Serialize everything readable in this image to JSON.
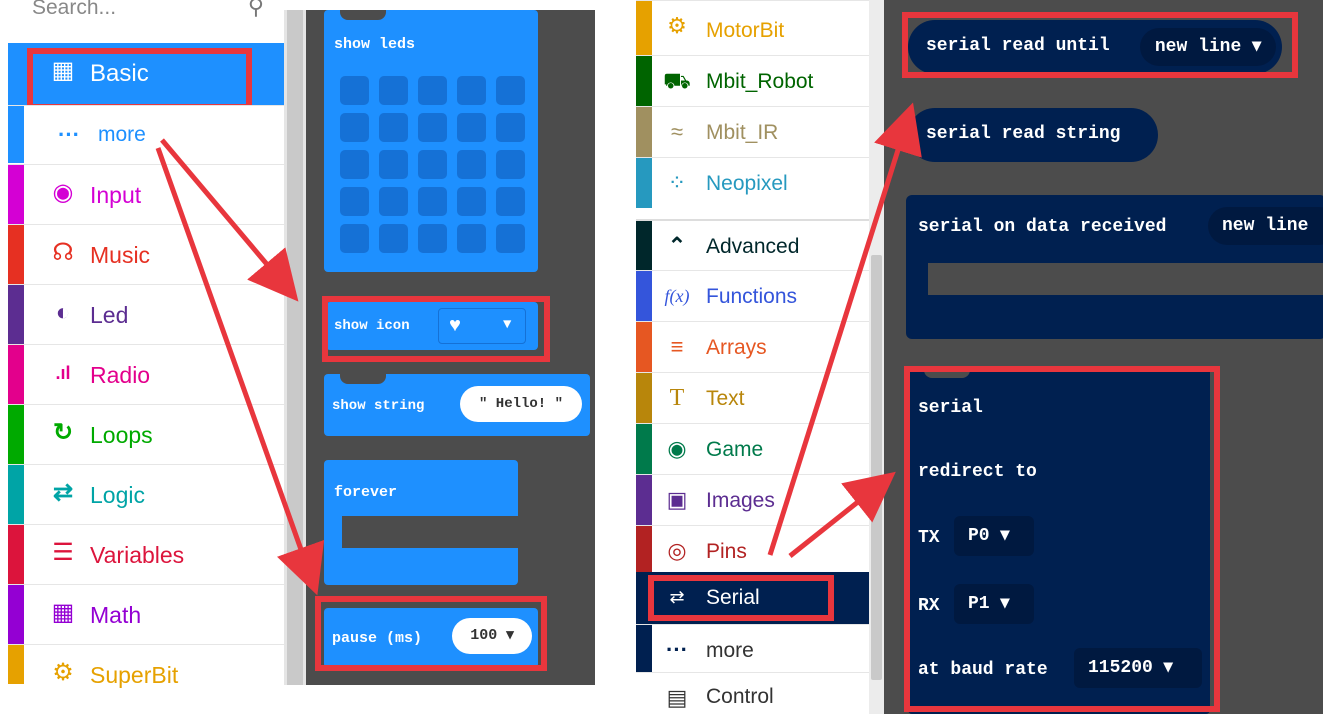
{
  "left": {
    "search_placeholder": "Search...",
    "categories": [
      {
        "label": "Basic",
        "icon": "grid-icon",
        "color": "#1e90ff"
      },
      {
        "label": "more",
        "icon": "dots-icon",
        "color": "#1e90ff"
      },
      {
        "label": "Input",
        "icon": "radio-target-icon",
        "color": "#d400d4"
      },
      {
        "label": "Music",
        "icon": "headphones-icon",
        "color": "#e63022"
      },
      {
        "label": "Led",
        "icon": "toggle-icon",
        "color": "#5c2d91"
      },
      {
        "label": "Radio",
        "icon": "signal-bars-icon",
        "color": "#e3008c"
      },
      {
        "label": "Loops",
        "icon": "loop-arrow-icon",
        "color": "#00aa00"
      },
      {
        "label": "Logic",
        "icon": "shuffle-icon",
        "color": "#00a4a6"
      },
      {
        "label": "Variables",
        "icon": "lines-icon",
        "color": "#dc143c"
      },
      {
        "label": "Math",
        "icon": "calculator-icon",
        "color": "#9400d3"
      },
      {
        "label": "SuperBit",
        "icon": "gears-icon",
        "color": "#e6a100"
      }
    ],
    "blocks": {
      "show_leds": "show leds",
      "show_icon": "show icon",
      "show_string": "show string",
      "show_string_value": "\" Hello! \"",
      "forever": "forever",
      "pause": "pause (ms)",
      "pause_value": "100 ▾"
    }
  },
  "right": {
    "categories": [
      {
        "label": "MotorBit",
        "icon": "gears-icon",
        "color": "#e6a100"
      },
      {
        "label": "Mbit_Robot",
        "icon": "car-icon",
        "color": "#006400"
      },
      {
        "label": "Mbit_IR",
        "icon": "wifi-icon",
        "color": "#a09060"
      },
      {
        "label": "Neopixel",
        "icon": "spinner-icon",
        "color": "#2699bf"
      },
      {
        "label": "Advanced",
        "icon": "chevron-up-icon",
        "color": "#00272b"
      },
      {
        "label": "Functions",
        "icon": "function-icon",
        "color": "#3455db"
      },
      {
        "label": "Arrays",
        "icon": "list-numbered-icon",
        "color": "#e65722"
      },
      {
        "label": "Text",
        "icon": "text-t-icon",
        "color": "#b8860b"
      },
      {
        "label": "Game",
        "icon": "gamepad-icon",
        "color": "#007a4b"
      },
      {
        "label": "Images",
        "icon": "image-icon",
        "color": "#5c2d91"
      },
      {
        "label": "Pins",
        "icon": "target-icon",
        "color": "#b22222"
      },
      {
        "label": "Serial",
        "icon": "usb-icon",
        "color": "#002050"
      },
      {
        "label": "more",
        "icon": "dots-icon",
        "color": "#002050"
      },
      {
        "label": "Control",
        "icon": "server-icon",
        "color": "#333333"
      }
    ],
    "blocks": {
      "read_until": "serial read until",
      "read_until_value": "new line ▾",
      "read_string": "serial read string",
      "on_data": "serial on data received",
      "on_data_value": "new line",
      "redirect_serial": "serial",
      "redirect_to": "redirect to",
      "tx_label": "TX",
      "tx_value": "P0 ▾",
      "rx_label": "RX",
      "rx_value": "P1 ▾",
      "baud_label": "at baud rate",
      "baud_value": "115200 ▾"
    }
  },
  "colors": {
    "highlight": "#e8363d",
    "basic": "#1e90ff",
    "serial": "#002050"
  }
}
